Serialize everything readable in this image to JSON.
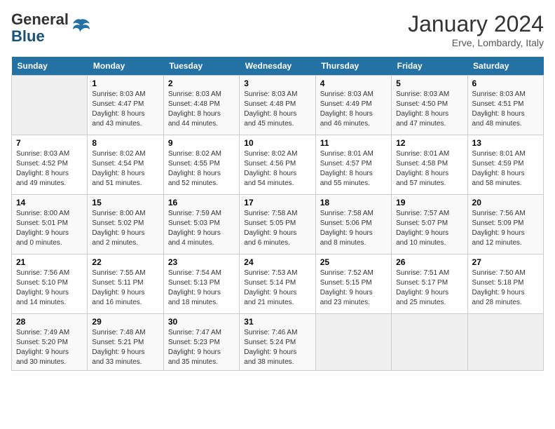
{
  "header": {
    "logo_general": "General",
    "logo_blue": "Blue",
    "month_title": "January 2024",
    "location": "Erve, Lombardy, Italy"
  },
  "days_of_week": [
    "Sunday",
    "Monday",
    "Tuesday",
    "Wednesday",
    "Thursday",
    "Friday",
    "Saturday"
  ],
  "weeks": [
    [
      {
        "day": "",
        "info": ""
      },
      {
        "day": "1",
        "info": "Sunrise: 8:03 AM\nSunset: 4:47 PM\nDaylight: 8 hours\nand 43 minutes."
      },
      {
        "day": "2",
        "info": "Sunrise: 8:03 AM\nSunset: 4:48 PM\nDaylight: 8 hours\nand 44 minutes."
      },
      {
        "day": "3",
        "info": "Sunrise: 8:03 AM\nSunset: 4:48 PM\nDaylight: 8 hours\nand 45 minutes."
      },
      {
        "day": "4",
        "info": "Sunrise: 8:03 AM\nSunset: 4:49 PM\nDaylight: 8 hours\nand 46 minutes."
      },
      {
        "day": "5",
        "info": "Sunrise: 8:03 AM\nSunset: 4:50 PM\nDaylight: 8 hours\nand 47 minutes."
      },
      {
        "day": "6",
        "info": "Sunrise: 8:03 AM\nSunset: 4:51 PM\nDaylight: 8 hours\nand 48 minutes."
      }
    ],
    [
      {
        "day": "7",
        "info": "Sunrise: 8:03 AM\nSunset: 4:52 PM\nDaylight: 8 hours\nand 49 minutes."
      },
      {
        "day": "8",
        "info": "Sunrise: 8:02 AM\nSunset: 4:54 PM\nDaylight: 8 hours\nand 51 minutes."
      },
      {
        "day": "9",
        "info": "Sunrise: 8:02 AM\nSunset: 4:55 PM\nDaylight: 8 hours\nand 52 minutes."
      },
      {
        "day": "10",
        "info": "Sunrise: 8:02 AM\nSunset: 4:56 PM\nDaylight: 8 hours\nand 54 minutes."
      },
      {
        "day": "11",
        "info": "Sunrise: 8:01 AM\nSunset: 4:57 PM\nDaylight: 8 hours\nand 55 minutes."
      },
      {
        "day": "12",
        "info": "Sunrise: 8:01 AM\nSunset: 4:58 PM\nDaylight: 8 hours\nand 57 minutes."
      },
      {
        "day": "13",
        "info": "Sunrise: 8:01 AM\nSunset: 4:59 PM\nDaylight: 8 hours\nand 58 minutes."
      }
    ],
    [
      {
        "day": "14",
        "info": "Sunrise: 8:00 AM\nSunset: 5:01 PM\nDaylight: 9 hours\nand 0 minutes."
      },
      {
        "day": "15",
        "info": "Sunrise: 8:00 AM\nSunset: 5:02 PM\nDaylight: 9 hours\nand 2 minutes."
      },
      {
        "day": "16",
        "info": "Sunrise: 7:59 AM\nSunset: 5:03 PM\nDaylight: 9 hours\nand 4 minutes."
      },
      {
        "day": "17",
        "info": "Sunrise: 7:58 AM\nSunset: 5:05 PM\nDaylight: 9 hours\nand 6 minutes."
      },
      {
        "day": "18",
        "info": "Sunrise: 7:58 AM\nSunset: 5:06 PM\nDaylight: 9 hours\nand 8 minutes."
      },
      {
        "day": "19",
        "info": "Sunrise: 7:57 AM\nSunset: 5:07 PM\nDaylight: 9 hours\nand 10 minutes."
      },
      {
        "day": "20",
        "info": "Sunrise: 7:56 AM\nSunset: 5:09 PM\nDaylight: 9 hours\nand 12 minutes."
      }
    ],
    [
      {
        "day": "21",
        "info": "Sunrise: 7:56 AM\nSunset: 5:10 PM\nDaylight: 9 hours\nand 14 minutes."
      },
      {
        "day": "22",
        "info": "Sunrise: 7:55 AM\nSunset: 5:11 PM\nDaylight: 9 hours\nand 16 minutes."
      },
      {
        "day": "23",
        "info": "Sunrise: 7:54 AM\nSunset: 5:13 PM\nDaylight: 9 hours\nand 18 minutes."
      },
      {
        "day": "24",
        "info": "Sunrise: 7:53 AM\nSunset: 5:14 PM\nDaylight: 9 hours\nand 21 minutes."
      },
      {
        "day": "25",
        "info": "Sunrise: 7:52 AM\nSunset: 5:15 PM\nDaylight: 9 hours\nand 23 minutes."
      },
      {
        "day": "26",
        "info": "Sunrise: 7:51 AM\nSunset: 5:17 PM\nDaylight: 9 hours\nand 25 minutes."
      },
      {
        "day": "27",
        "info": "Sunrise: 7:50 AM\nSunset: 5:18 PM\nDaylight: 9 hours\nand 28 minutes."
      }
    ],
    [
      {
        "day": "28",
        "info": "Sunrise: 7:49 AM\nSunset: 5:20 PM\nDaylight: 9 hours\nand 30 minutes."
      },
      {
        "day": "29",
        "info": "Sunrise: 7:48 AM\nSunset: 5:21 PM\nDaylight: 9 hours\nand 33 minutes."
      },
      {
        "day": "30",
        "info": "Sunrise: 7:47 AM\nSunset: 5:23 PM\nDaylight: 9 hours\nand 35 minutes."
      },
      {
        "day": "31",
        "info": "Sunrise: 7:46 AM\nSunset: 5:24 PM\nDaylight: 9 hours\nand 38 minutes."
      },
      {
        "day": "",
        "info": ""
      },
      {
        "day": "",
        "info": ""
      },
      {
        "day": "",
        "info": ""
      }
    ]
  ]
}
